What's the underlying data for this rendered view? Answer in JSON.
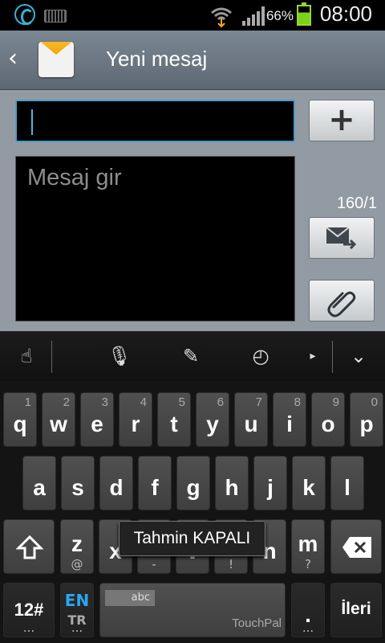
{
  "status_bar": {
    "battery": "66%",
    "time": "08:00"
  },
  "header": {
    "title": "Yeni mesaj"
  },
  "compose": {
    "recipient_value": "",
    "message_placeholder": "Mesaj gir",
    "counter": "160/1",
    "add_label": "+"
  },
  "keyboard": {
    "row1": [
      [
        "q",
        "1"
      ],
      [
        "w",
        "2"
      ],
      [
        "e",
        "3"
      ],
      [
        "r",
        "4"
      ],
      [
        "t",
        "5"
      ],
      [
        "y",
        "6"
      ],
      [
        "u",
        "7"
      ],
      [
        "i",
        "8"
      ],
      [
        "o",
        "9"
      ],
      [
        "p",
        "0"
      ]
    ],
    "row2": [
      "a",
      "s",
      "d",
      "f",
      "g",
      "h",
      "j",
      "k",
      "l"
    ],
    "row3": [
      [
        "z",
        "@"
      ],
      [
        "x",
        "#"
      ],
      [
        "c",
        "-"
      ],
      [
        "v",
        "'"
      ],
      [
        "b",
        "!"
      ],
      [
        "n",
        "?"
      ],
      [
        "m",
        "?"
      ]
    ],
    "row3_sub": [
      "@",
      "-",
      "!",
      "?",
      "?"
    ],
    "tooltip": "Tahmin KAPALI",
    "num_key": "12#",
    "lang_primary": "EN",
    "lang_secondary": "TR",
    "space_small": "abc",
    "space_brand": "TouchPal",
    "dot": ".",
    "enter": "İleri"
  }
}
